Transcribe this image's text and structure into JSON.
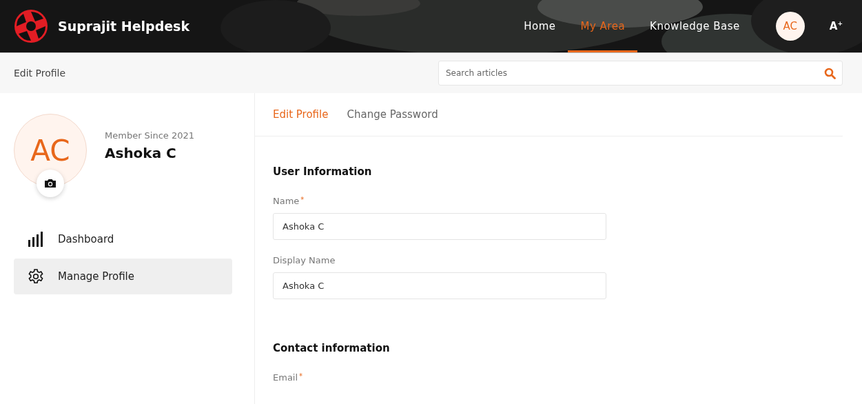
{
  "header": {
    "brand": "Suprajit Helpdesk",
    "nav": [
      {
        "label": "Home",
        "selected": false
      },
      {
        "label": "My Area",
        "selected": true
      },
      {
        "label": "Knowledge Base",
        "selected": false
      }
    ],
    "avatar": "AC",
    "font_size_control": "A",
    "font_size_sup": "+"
  },
  "subbar": {
    "breadcrumb": "Edit Profile",
    "search": {
      "placeholder": "Search articles"
    }
  },
  "profile": {
    "initials": "AC",
    "member_since": "Member Since 2021",
    "name": "Ashoka C"
  },
  "sidebar": {
    "items": [
      {
        "label": "Dashboard",
        "kind": "chart",
        "selected": false
      },
      {
        "label": "Manage Profile",
        "kind": "gear",
        "selected": true
      }
    ]
  },
  "tabs": [
    {
      "label": "Edit Profile",
      "selected": true
    },
    {
      "label": "Change Password",
      "selected": false
    }
  ],
  "sections": [
    {
      "title": "User Information",
      "fields": [
        {
          "label": "Name",
          "required_mark": "*",
          "value": "Ashoka C"
        },
        {
          "label": "Display Name",
          "value": "Ashoka C"
        }
      ]
    },
    {
      "title": "Contact information",
      "fields": [
        {
          "label": "Email",
          "required_mark": "*"
        }
      ]
    }
  ]
}
